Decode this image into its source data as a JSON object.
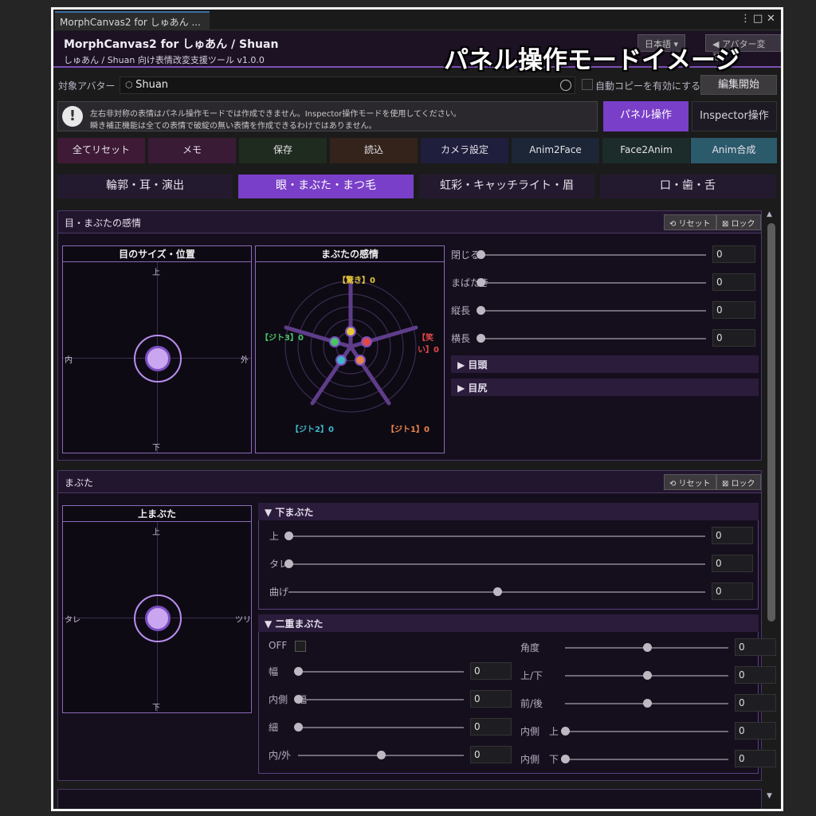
{
  "tab": {
    "title": "MorphCanvas2 for しゅあん ..."
  },
  "header": {
    "title": "MorphCanvas2 for しゅあん / Shuan",
    "subtitle": "しゅあん / Shuan 向け表情改変支援ツール v1.0.0",
    "btn_lang": "日本語 ▾",
    "btn_avatar": "◀ アバター変更"
  },
  "overlay_title": "パネル操作モードイメージ",
  "avatar_row": {
    "label": "対象アバター",
    "value": "Shuan",
    "autocopy_label": "自動コピーを有効にする",
    "edit_button": "編集開始"
  },
  "warning": {
    "line1": "左右非対称の表情はパネル操作モードでは作成できません。Inspector操作モードを使用してください。",
    "line2": "瞬き補正機能は全ての表情で破綻の無い表情を作成できるわけではありません。"
  },
  "modes": {
    "panel": "パネル操作",
    "inspector": "Inspector操作"
  },
  "actions": [
    "全てリセット",
    "メモ",
    "保存",
    "読込",
    "カメラ設定",
    "Anim2Face",
    "Face2Anim",
    "Anim合成"
  ],
  "categories": [
    "輪郭・耳・演出",
    "眼・まぶた・まつ毛",
    "虹彩・キャッチライト・眉",
    "口・歯・舌"
  ],
  "common": {
    "reset": "⟲ リセット",
    "lock": "⊠ ロック"
  },
  "panel1": {
    "title": "目・まぶたの感情",
    "pad_title": "目のサイズ・位置",
    "pad_top": "上",
    "pad_bottom": "下",
    "pad_left": "内",
    "pad_right": "外",
    "radar_title": "まぶたの感情",
    "radar_labels": [
      "【驚き】0",
      "【笑い】0",
      "【ジト1】0",
      "【ジト2】0",
      "【ジト3】0"
    ],
    "sliders": [
      {
        "label": "閉じる",
        "value": "0",
        "pos": 0
      },
      {
        "label": "まばたき",
        "value": "0",
        "pos": 0
      },
      {
        "label": "縦長",
        "value": "0",
        "pos": 0
      },
      {
        "label": "横長",
        "value": "0",
        "pos": 0
      }
    ],
    "folds": [
      "▶  目頭",
      "▶  目尻"
    ]
  },
  "panel2": {
    "title": "まぶた",
    "pad_title": "上まぶた",
    "pad_top": "上",
    "pad_bottom": "下",
    "pad_left": "タレ",
    "pad_right": "ツリ",
    "lower_title": "▼  下まぶた",
    "lower_sliders": [
      {
        "label": "上",
        "value": "0",
        "pos": 0
      },
      {
        "label": "タレ",
        "value": "0",
        "pos": 0
      },
      {
        "label": "曲げ",
        "value": "0",
        "pos": 0.5
      }
    ],
    "double_title": "▼  二重まぶた",
    "off_label": "OFF",
    "double_left": [
      {
        "label": "幅",
        "value": "0",
        "pos": 0
      },
      {
        "label": "内側　幅",
        "value": "0",
        "pos": 0
      },
      {
        "label": "細",
        "value": "0",
        "pos": 0
      },
      {
        "label": "内/外",
        "value": "0",
        "pos": 0.5
      }
    ],
    "double_right": [
      {
        "label": "角度",
        "value": "0",
        "pos": 0.5
      },
      {
        "label": "上/下",
        "value": "0",
        "pos": 0.5
      },
      {
        "label": "前/後",
        "value": "0",
        "pos": 0.5
      },
      {
        "label": "内側　上",
        "value": "0",
        "pos": 0
      },
      {
        "label": "内側　下",
        "value": "0",
        "pos": 0
      }
    ]
  },
  "colors": {
    "accent": "#7a3fc8",
    "surprise": "#e6c73a",
    "laugh": "#e04848",
    "jito1": "#e8844a",
    "jito2": "#3fb7c9",
    "jito3": "#48c464"
  }
}
